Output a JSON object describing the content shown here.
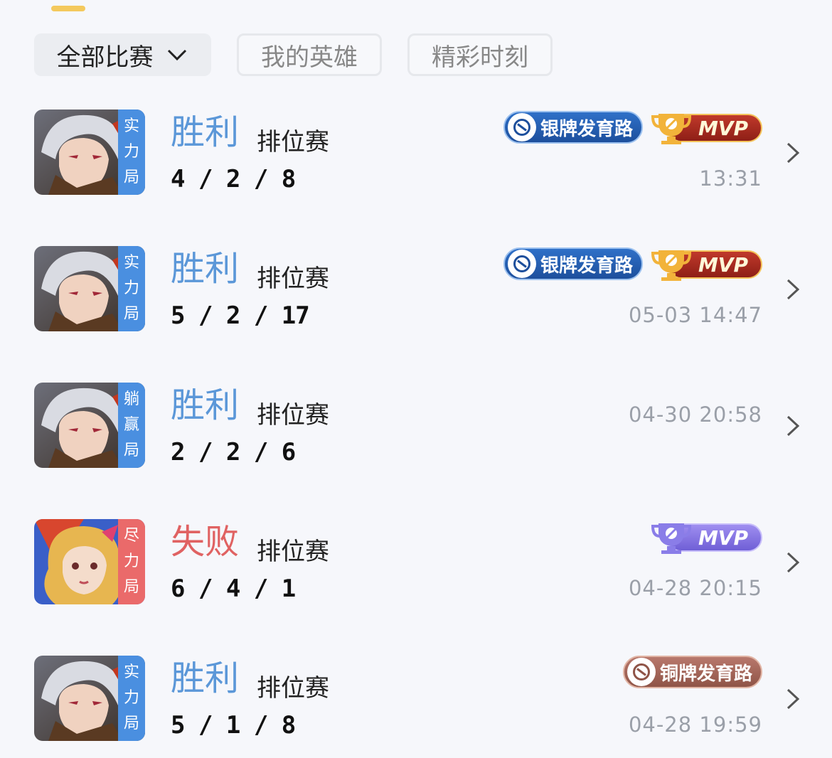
{
  "filters": {
    "all_matches": "全部比赛",
    "my_heroes": "我的英雄",
    "highlights": "精彩时刻"
  },
  "colors": {
    "win": "#5b97d8",
    "lose": "#e06262",
    "tag_blue": "#4a8fe0",
    "tag_red": "#ea6a6a"
  },
  "matches": [
    {
      "hero": "silver-hair-hero",
      "tag": [
        "实",
        "力",
        "局"
      ],
      "tag_color": "blue",
      "result": "胜利",
      "mode": "排位赛",
      "kda": "4 / 2 / 8",
      "time": "13:31",
      "badge": "银牌发育路",
      "mvp": "MVP"
    },
    {
      "hero": "silver-hair-hero",
      "tag": [
        "实",
        "力",
        "局"
      ],
      "tag_color": "blue",
      "result": "胜利",
      "mode": "排位赛",
      "kda": "5 / 2 / 17",
      "time": "05-03 14:47",
      "badge": "银牌发育路",
      "mvp": "MVP"
    },
    {
      "hero": "silver-hair-hero",
      "tag": [
        "躺",
        "赢",
        "局"
      ],
      "tag_color": "blue",
      "result": "胜利",
      "mode": "排位赛",
      "kda": "2 / 2 / 6",
      "time": "04-30 20:58"
    },
    {
      "hero": "blonde-hair-hero",
      "tag": [
        "尽",
        "力",
        "局"
      ],
      "tag_color": "red",
      "result": "失败",
      "mode": "排位赛",
      "kda": "6 / 4 / 1",
      "time": "04-28 20:15",
      "mvp": "MVP"
    },
    {
      "hero": "silver-hair-hero",
      "tag": [
        "实",
        "力",
        "局"
      ],
      "tag_color": "blue",
      "result": "胜利",
      "mode": "排位赛",
      "kda": "5 / 1 / 8",
      "time": "04-28 19:59",
      "badge": "铜牌发育路"
    }
  ]
}
